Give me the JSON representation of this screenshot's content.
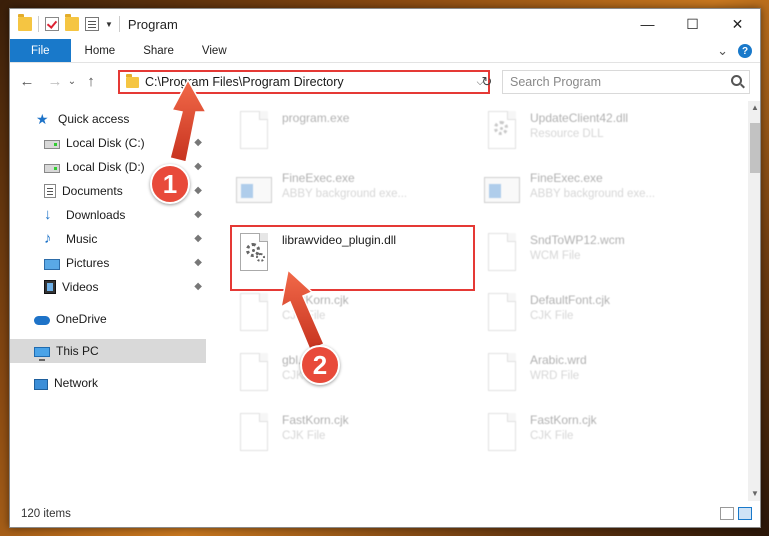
{
  "window": {
    "title": "Program",
    "minimize": "—",
    "maximize": "☐",
    "close": "✕"
  },
  "ribbon": {
    "tabs": [
      "File",
      "Home",
      "Share",
      "View"
    ],
    "expand": "⌄",
    "help": "?"
  },
  "address": {
    "path": "C:\\Program Files\\Program Directory",
    "caret": "⌵",
    "refresh": "↻"
  },
  "nav": {
    "back": "←",
    "forward": "→",
    "recent": "⌄",
    "up": "↑"
  },
  "search": {
    "placeholder": "Search Program"
  },
  "sidebar": {
    "items": [
      {
        "label": "Quick access",
        "icon": "star-icon"
      },
      {
        "label": "Local Disk (C:)",
        "icon": "disk-icon"
      },
      {
        "label": "Local Disk (D:)",
        "icon": "disk-icon"
      },
      {
        "label": "Documents",
        "icon": "documents-icon"
      },
      {
        "label": "Downloads",
        "icon": "downloads-icon"
      },
      {
        "label": "Music",
        "icon": "music-icon"
      },
      {
        "label": "Pictures",
        "icon": "pictures-icon"
      },
      {
        "label": "Videos",
        "icon": "videos-icon"
      },
      {
        "label": "OneDrive",
        "icon": "onedrive-icon"
      },
      {
        "label": "This PC",
        "icon": "this-pc-icon"
      },
      {
        "label": "Network",
        "icon": "network-icon"
      }
    ],
    "pin_glyph": "📌"
  },
  "files": [
    {
      "name": "program.exe",
      "type": "",
      "icon": "app-icon"
    },
    {
      "name": "UpdateClient42.dll",
      "type": "Resource DLL",
      "icon": "dll-icon"
    },
    {
      "name": "FineExec.exe",
      "type": "ABBY background exe...",
      "icon": "exe-icon"
    },
    {
      "name": "FineExec.exe",
      "type": "ABBY background exe...",
      "icon": "exe-icon"
    },
    {
      "name": "librawvideo_plugin.dll",
      "type": "",
      "icon": "dll-gear-icon"
    },
    {
      "name": "SndToWP12.wcm",
      "type": "WCM File",
      "icon": "file-icon"
    },
    {
      "name": "FastKorn.cjk",
      "type": "CJK File",
      "icon": "file-icon"
    },
    {
      "name": "DefaultFont.cjk",
      "type": "CJK File",
      "icon": "file-icon"
    },
    {
      "name": "gbl.cjk",
      "type": "CJK File",
      "icon": "file-icon"
    },
    {
      "name": "Arabic.wrd",
      "type": "WRD File",
      "icon": "file-icon"
    },
    {
      "name": "FastKorn.cjk",
      "type": "CJK File",
      "icon": "file-icon"
    },
    {
      "name": "FastKorn.cjk",
      "type": "CJK File",
      "icon": "file-icon"
    }
  ],
  "markers": [
    "1",
    "2"
  ],
  "status": {
    "count": "120 items"
  },
  "colors": {
    "accent": "#1979ca",
    "highlight": "#e53935",
    "marker": "#e84a3a"
  }
}
